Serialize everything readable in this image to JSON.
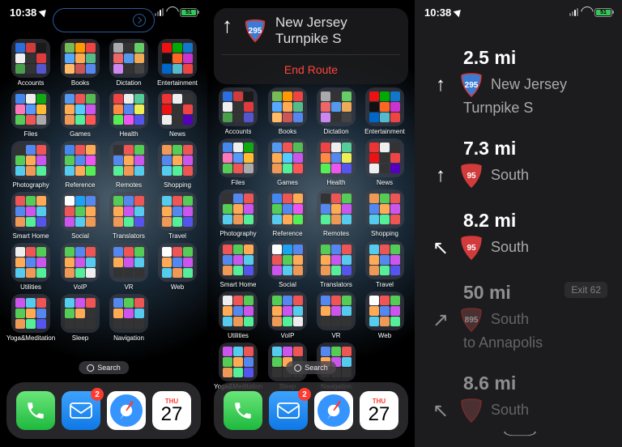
{
  "status": {
    "time": "10:38",
    "battery": "51"
  },
  "folders": [
    {
      "label": "Accounts",
      "c": [
        "#2a6fdb",
        "#d13b3b",
        "#1a1a1a",
        "#f0f0f0",
        "#333",
        "#e03b3b",
        "#4a9e4a",
        "#333",
        "#55c"
      ]
    },
    {
      "label": "Books",
      "c": [
        "#7b5",
        "#f90",
        "#e44",
        "#5af",
        "#fa5",
        "#5b8",
        "#fb6",
        "#c55",
        "#58e"
      ]
    },
    {
      "label": "Dictation",
      "c": [
        "#aaa",
        "#333",
        "#6c6",
        "#e66",
        "#59e",
        "#ea5",
        "#c8e",
        "#333",
        "#444"
      ]
    },
    {
      "label": "Entertainment",
      "c": [
        "#e11",
        "#0a0",
        "#17c",
        "#111",
        "#f62",
        "#c3c",
        "#06c",
        "#5bc",
        "#e44"
      ]
    },
    {
      "label": "Files",
      "c": [
        "#48e",
        "#eee",
        "#1a1",
        "#f7b",
        "#59f",
        "#fb3",
        "#5c5",
        "#e55",
        "#aaa"
      ]
    },
    {
      "label": "Games",
      "c": [
        "#59e",
        "#e55",
        "#5b5",
        "#fa5",
        "#5cf",
        "#c5e",
        "#e95",
        "#5e9",
        "#f55"
      ]
    },
    {
      "label": "Health",
      "c": [
        "#e44",
        "#eee",
        "#5c9",
        "#f84",
        "#58e",
        "#ee5",
        "#5e5",
        "#e5e",
        "#55e"
      ]
    },
    {
      "label": "News",
      "c": [
        "#e33",
        "#eee",
        "#333",
        "#e11",
        "#333",
        "#e44",
        "#eee",
        "#333",
        "#50b"
      ]
    },
    {
      "label": "Photography",
      "c": [
        "#333",
        "#58e",
        "#e55",
        "#5c5",
        "#fa5",
        "#c5e",
        "#5ce",
        "#e95",
        "#5e9"
      ]
    },
    {
      "label": "Reference",
      "c": [
        "#48e",
        "#e55",
        "#fa5",
        "#5c5",
        "#58e",
        "#e5e",
        "#5ce",
        "#fa5",
        "#5e5"
      ]
    },
    {
      "label": "Remotes",
      "c": [
        "#333",
        "#e55",
        "#5c5",
        "#58e",
        "#fa5",
        "#c5e",
        "#5e9",
        "#e95",
        "#5ce"
      ]
    },
    {
      "label": "Shopping",
      "c": [
        "#e95",
        "#5c5",
        "#e55",
        "#58e",
        "#fa5",
        "#c5e",
        "#5ce",
        "#5e9",
        "#e55"
      ]
    },
    {
      "label": "Smart Home",
      "c": [
        "#e55",
        "#5c5",
        "#fa5",
        "#58e",
        "#c5e",
        "#5ce",
        "#e95",
        "#5e9",
        "#55e"
      ]
    },
    {
      "label": "Social",
      "c": [
        "#ffffff",
        "#1da1f2",
        "#58e",
        "#e55",
        "#5c5",
        "#fa5",
        "#c5e",
        "#5ce",
        "#e95"
      ]
    },
    {
      "label": "Translators",
      "c": [
        "#5c5",
        "#58e",
        "#e55",
        "#fa5",
        "#c5e",
        "#5ce",
        "#e95",
        "#5e9",
        "#55e"
      ]
    },
    {
      "label": "Travel",
      "c": [
        "#5ce",
        "#e55",
        "#5c5",
        "#fa5",
        "#58e",
        "#c5e",
        "#e95",
        "#5e9",
        "#55e"
      ]
    },
    {
      "label": "Utilities",
      "c": [
        "#eee",
        "#e55",
        "#5c5",
        "#fa5",
        "#58e",
        "#c5e",
        "#5ce",
        "#e95",
        "#5e9"
      ]
    },
    {
      "label": "VoIP",
      "c": [
        "#5c5",
        "#58e",
        "#e55",
        "#fa5",
        "#c5e",
        "#5ce",
        "#e95",
        "#5e9",
        "#eee"
      ]
    },
    {
      "label": "VR",
      "c": [
        "#58e",
        "#e55",
        "#5c5",
        "#fa5",
        "#c5e",
        "#5ce",
        "#333",
        "#333",
        "#333"
      ]
    },
    {
      "label": "Web",
      "c": [
        "#ffffff",
        "#e55",
        "#5c5",
        "#fa5",
        "#58e",
        "#c5e",
        "#5ce",
        "#e95",
        "#5e9"
      ]
    },
    {
      "label": "Yoga&Meditation",
      "c": [
        "#c5e",
        "#5ce",
        "#e55",
        "#5c5",
        "#fa5",
        "#58e",
        "#e95",
        "#5e9",
        "#55e"
      ]
    },
    {
      "label": "Sleep",
      "c": [
        "#5ce",
        "#c5e",
        "#e55",
        "#5c5",
        "#fa5",
        "#333",
        "#333",
        "#333",
        "#333"
      ]
    },
    {
      "label": "Navigation",
      "c": [
        "#58e",
        "#5c5",
        "#e55",
        "#fa5",
        "#c5e",
        "#5ce",
        "#333",
        "#333",
        "#333"
      ]
    }
  ],
  "search": "Search",
  "dock": {
    "badge": "2",
    "cal_day": "THU",
    "cal_date": "27"
  },
  "banner": {
    "road": "New Jersey Turnpike S",
    "shield_num": "295",
    "end": "End Route"
  },
  "steps": [
    {
      "dist": "2.5 mi",
      "shield": "295",
      "shield_color": "#3b7bd4",
      "text": "New Jersey",
      "sub": "Turnpike S",
      "arrow": "↑"
    },
    {
      "dist": "7.3 mi",
      "shield": "95",
      "shield_color": "#d13b3b",
      "text": "South",
      "arrow": "↑"
    },
    {
      "dist": "8.2 mi",
      "shield": "95",
      "shield_color": "#d13b3b",
      "text": "South",
      "arrow": "↖"
    },
    {
      "dist": "50 mi",
      "shield": "895",
      "shield_color": "#7a4444",
      "text": "South",
      "sub": "to Annapolis",
      "arrow": "↗",
      "exit": "Exit 62",
      "faded": true
    },
    {
      "dist": "8.6 mi",
      "shield": "",
      "shield_color": "#7a4444",
      "text": "South",
      "arrow": "↖",
      "faded": true
    }
  ]
}
